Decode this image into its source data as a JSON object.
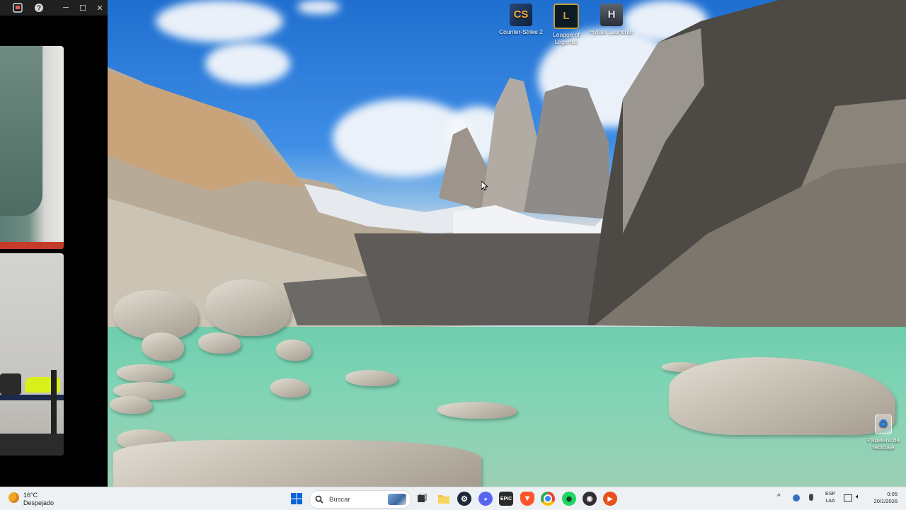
{
  "desktop": {
    "icons": [
      {
        "label": "Counter-Strike 2",
        "icon": "counter-strike-icon"
      },
      {
        "label": "League of Legends",
        "icon": "league-of-legends-icon"
      },
      {
        "label": "Hytale Launcher",
        "icon": "hytale-icon"
      },
      {
        "label": "Papelera de reciclaje",
        "icon": "recycle-bin-icon"
      }
    ]
  },
  "camera_window": {
    "buttons": [
      "app-icon",
      "help-icon",
      "minimize-icon",
      "maximize-icon",
      "close-icon"
    ]
  },
  "taskbar": {
    "weather": {
      "temp": "16°C",
      "condition": "Despejado"
    },
    "search": {
      "placeholder": "Buscar"
    },
    "apps": [
      "start-icon",
      "search-icon",
      "task-view-icon",
      "file-explorer-icon",
      "steam-icon",
      "discord-icon",
      "epic-games-icon",
      "brave-icon",
      "chrome-icon",
      "app-green-icon",
      "obs-icon",
      "media-icon"
    ],
    "tray": {
      "lang": "ESP",
      "region": "LAA",
      "time": "0:05",
      "date": "20/1/2026"
    }
  },
  "colors": {
    "sky": "#2f7fdc",
    "lake": "#7dd4b4",
    "taskbar": "#eef1f4",
    "windows_blue": "#0a64d8"
  }
}
